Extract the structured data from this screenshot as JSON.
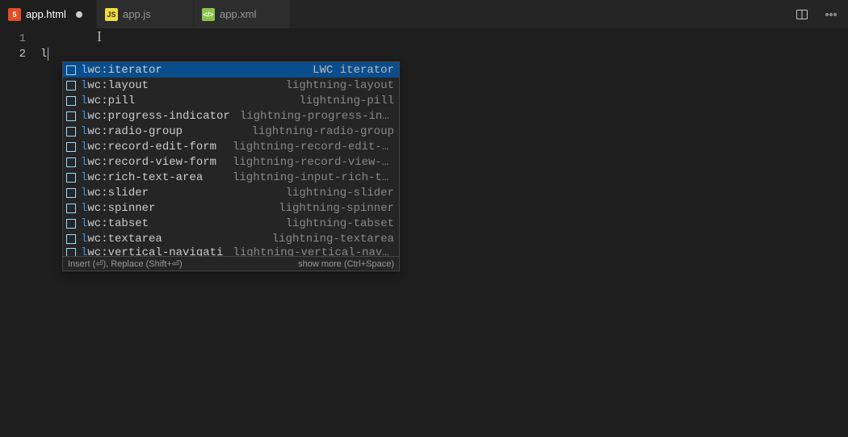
{
  "tabs": [
    {
      "label": "app.html",
      "icon": "html",
      "iconGlyph": "5",
      "active": true,
      "dirty": true
    },
    {
      "label": "app.js",
      "icon": "js",
      "iconGlyph": "JS",
      "active": false,
      "dirty": false
    },
    {
      "label": "app.xml",
      "icon": "xml",
      "iconGlyph": "</>",
      "active": false,
      "dirty": false
    }
  ],
  "editor": {
    "lines": [
      "",
      "l"
    ],
    "activeLine": 2,
    "typedPrefix": "l"
  },
  "suggest": {
    "items": [
      {
        "label": "lwc:iterator",
        "detail": "LWC iterator",
        "selected": true
      },
      {
        "label": "lwc:layout",
        "detail": "lightning-layout",
        "selected": false
      },
      {
        "label": "lwc:pill",
        "detail": "lightning-pill",
        "selected": false
      },
      {
        "label": "lwc:progress-indicator",
        "detail": "lightning-progress-indica…",
        "selected": false
      },
      {
        "label": "lwc:radio-group",
        "detail": "lightning-radio-group",
        "selected": false
      },
      {
        "label": "lwc:record-edit-form",
        "detail": "lightning-record-edit-form",
        "selected": false
      },
      {
        "label": "lwc:record-view-form",
        "detail": "lightning-record-view-form",
        "selected": false
      },
      {
        "label": "lwc:rich-text-area",
        "detail": "lightning-input-rich-text",
        "selected": false
      },
      {
        "label": "lwc:slider",
        "detail": "lightning-slider",
        "selected": false
      },
      {
        "label": "lwc:spinner",
        "detail": "lightning-spinner",
        "selected": false
      },
      {
        "label": "lwc:tabset",
        "detail": "lightning-tabset",
        "selected": false
      },
      {
        "label": "lwc:textarea",
        "detail": "lightning-textarea",
        "selected": false
      },
      {
        "label": "lwc:vertical-navigati",
        "detail": "lightning-vertical-navig…",
        "selected": false,
        "truncated": true
      }
    ],
    "statusLeft": "Insert (⏎), Replace (Shift+⏎)",
    "statusRight": "show more (Ctrl+Space)"
  }
}
